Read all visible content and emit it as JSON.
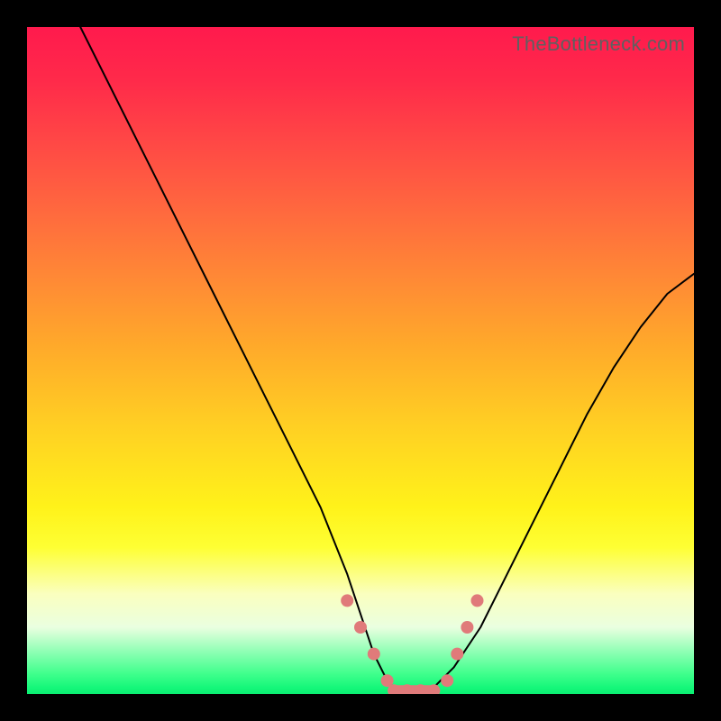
{
  "watermark": "TheBottleneck.com",
  "colors": {
    "frame": "#000000",
    "marker": "#e07a7a",
    "curve": "#000000"
  },
  "chart_data": {
    "type": "line",
    "title": "",
    "xlabel": "",
    "ylabel": "",
    "xlim": [
      0,
      100
    ],
    "ylim": [
      0,
      100
    ],
    "grid": false,
    "legend": false,
    "series": [
      {
        "name": "bottleneck-curve",
        "x": [
          8,
          12,
          16,
          20,
          24,
          28,
          32,
          36,
          40,
          44,
          48,
          50,
          52,
          54,
          56,
          58,
          60,
          64,
          68,
          72,
          76,
          80,
          84,
          88,
          92,
          96,
          100
        ],
        "values": [
          100,
          92,
          84,
          76,
          68,
          60,
          52,
          44,
          36,
          28,
          18,
          12,
          6,
          2,
          0,
          0,
          0,
          4,
          10,
          18,
          26,
          34,
          42,
          49,
          55,
          60,
          63
        ]
      }
    ],
    "markers": [
      {
        "x": 48,
        "y": 14
      },
      {
        "x": 50,
        "y": 10
      },
      {
        "x": 52,
        "y": 6
      },
      {
        "x": 54,
        "y": 2
      },
      {
        "x": 55,
        "y": 0.5
      },
      {
        "x": 57,
        "y": 0.5
      },
      {
        "x": 59,
        "y": 0.5
      },
      {
        "x": 61,
        "y": 0.5
      },
      {
        "x": 63,
        "y": 2
      },
      {
        "x": 64.5,
        "y": 6
      },
      {
        "x": 66,
        "y": 10
      },
      {
        "x": 67.5,
        "y": 14
      }
    ],
    "gradient_stops": [
      {
        "pos": 0.0,
        "color": "#ff1a4d"
      },
      {
        "pos": 0.5,
        "color": "#ffaa2a"
      },
      {
        "pos": 0.75,
        "color": "#fff21a"
      },
      {
        "pos": 0.9,
        "color": "#eaffe0"
      },
      {
        "pos": 1.0,
        "color": "#0af072"
      }
    ]
  }
}
